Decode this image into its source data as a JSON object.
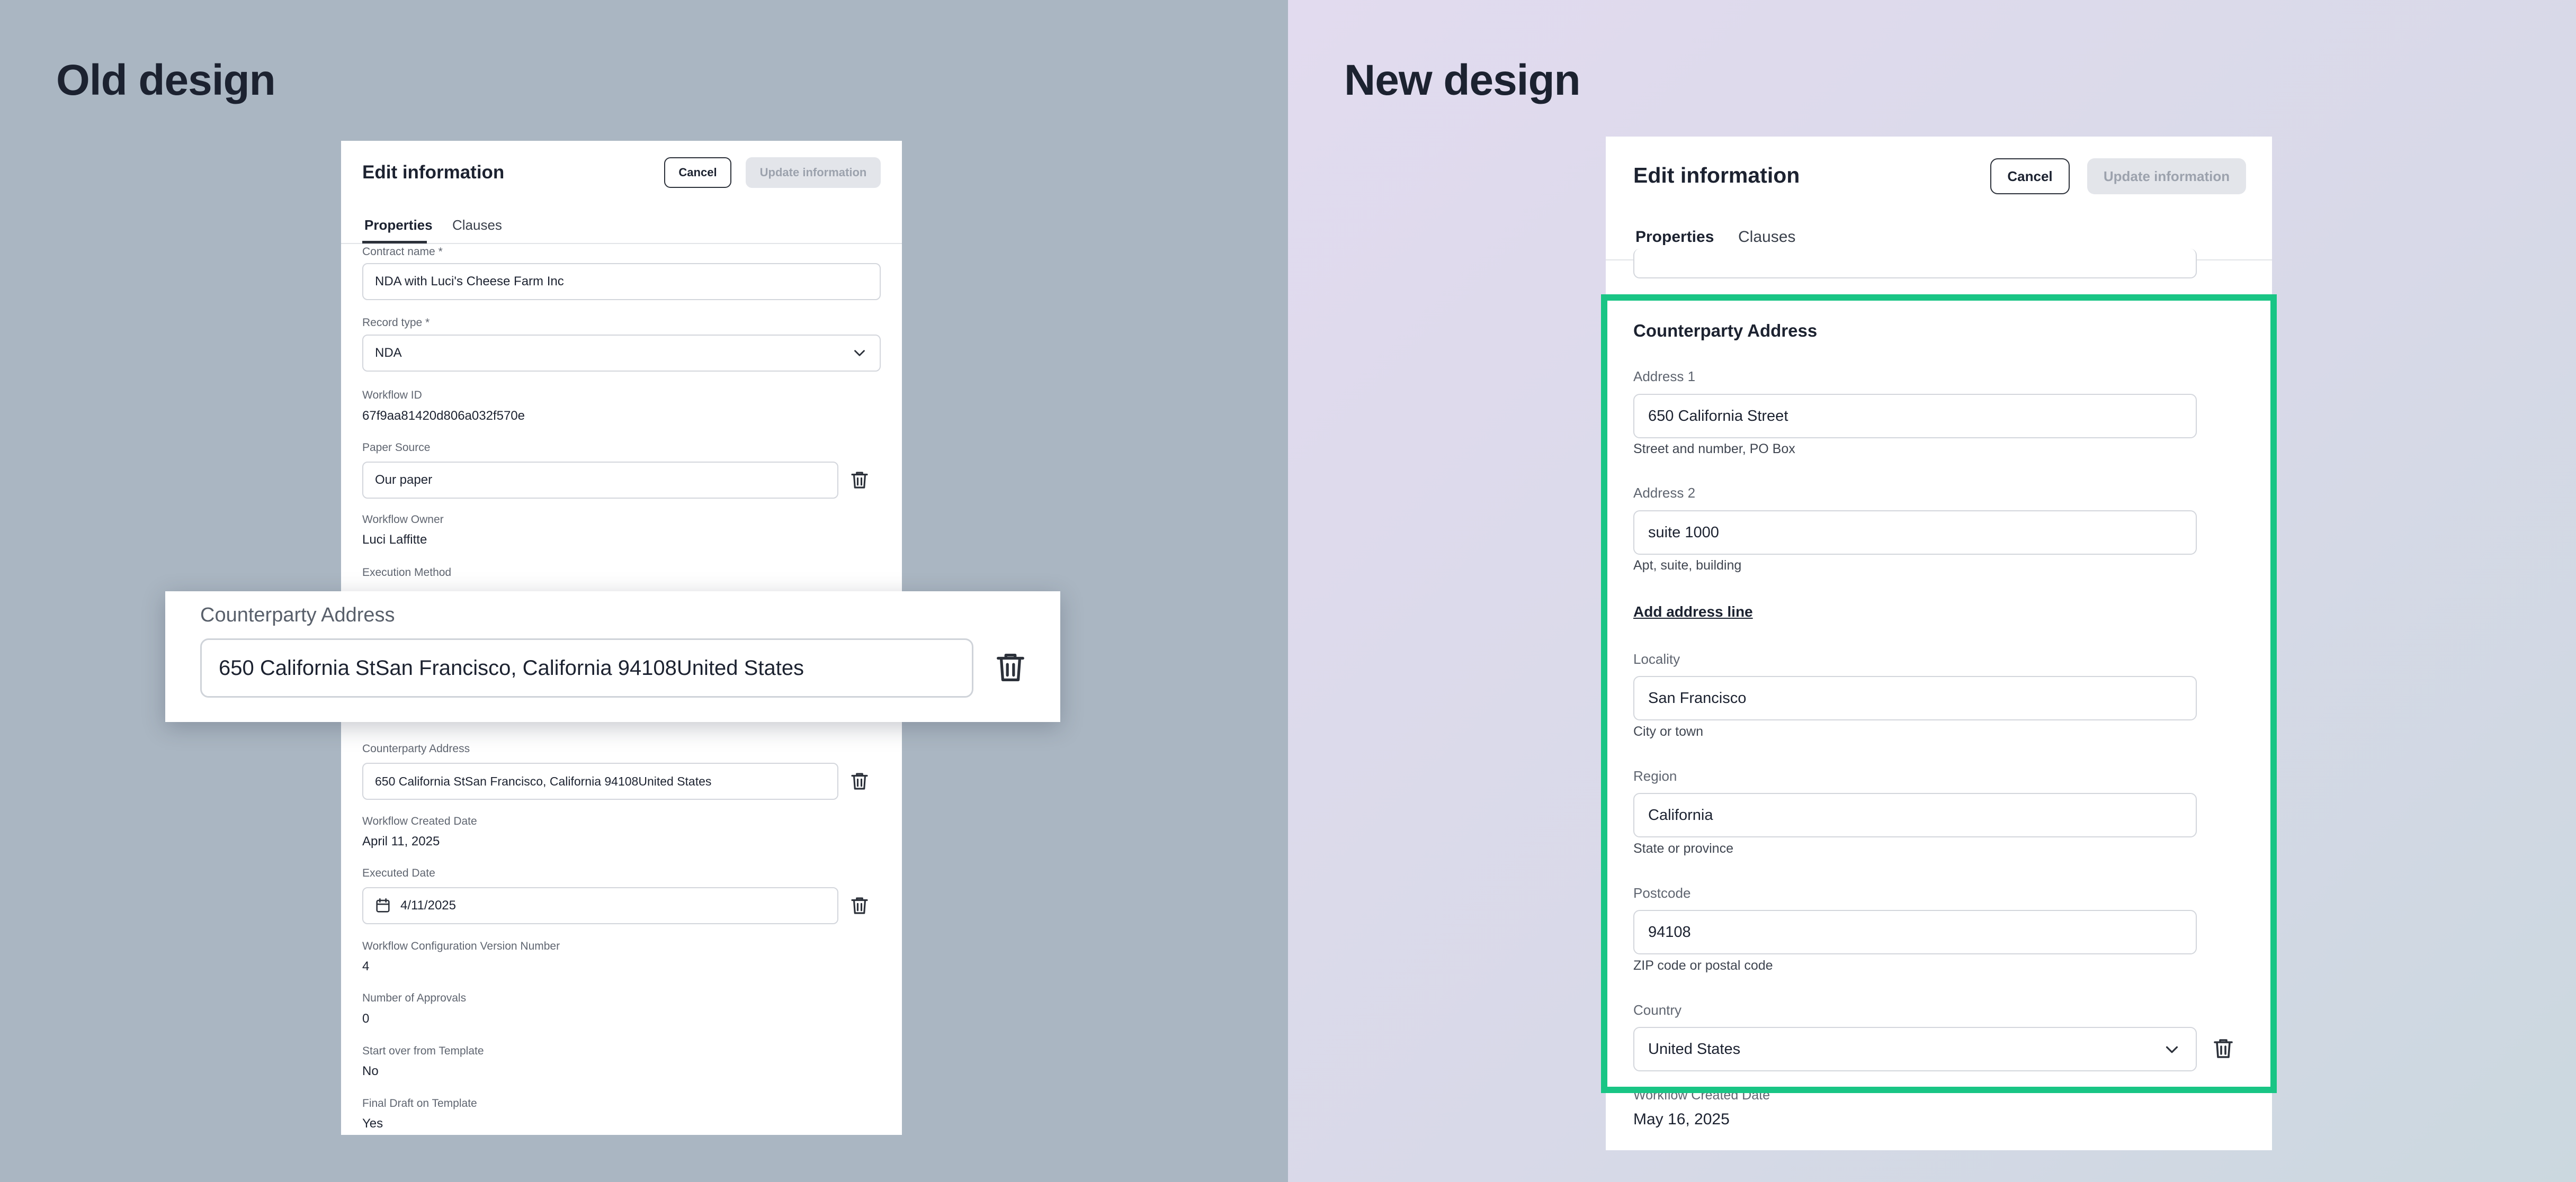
{
  "old": {
    "heading": "Old design",
    "form": {
      "title": "Edit information",
      "cancel_label": "Cancel",
      "update_label": "Update information",
      "tabs": [
        "Properties",
        "Clauses"
      ],
      "contract_name_label": "Contract name *",
      "contract_name_value": "NDA with Luci's Cheese Farm Inc",
      "record_type_label": "Record type *",
      "record_type_value": "NDA",
      "workflow_id_label": "Workflow ID",
      "workflow_id_value": "67f9aa81420d806a032f570e",
      "paper_source_label": "Paper Source",
      "paper_source_value": "Our paper",
      "workflow_owner_label": "Workflow Owner",
      "workflow_owner_value": "Luci Laffitte",
      "execution_method_label": "Execution Method",
      "counterparty_label": "Counterparty Address",
      "counterparty_value": "650 California StSan Francisco, California 94108United States",
      "created_label": "Workflow Created Date",
      "created_value": "April 11, 2025",
      "executed_label": "Executed Date",
      "executed_value": "4/11/2025",
      "config_label": "Workflow Configuration Version Number",
      "config_value": "4",
      "approvals_label": "Number of Approvals",
      "approvals_value": "0",
      "start_over_label": "Start over from Template",
      "start_over_value": "No",
      "final_draft_label": "Final Draft on Template",
      "final_draft_value": "Yes"
    },
    "zoom": {
      "label": "Counterparty Address",
      "value": "650 California StSan Francisco, California 94108United States"
    }
  },
  "new": {
    "heading": "New design",
    "form": {
      "title": "Edit information",
      "cancel_label": "Cancel",
      "update_label": "Update information",
      "tabs": [
        "Properties",
        "Clauses"
      ],
      "section_title": "Counterparty Address",
      "address1_label": "Address 1",
      "address1_value": "650 California Street",
      "address1_hint": "Street and number, PO Box",
      "address2_label": "Address 2",
      "address2_value": "suite 1000",
      "address2_hint": "Apt, suite, building",
      "add_line_label": "Add address line",
      "locality_label": "Locality",
      "locality_value": "San Francisco",
      "locality_hint": "City or town",
      "region_label": "Region",
      "region_value": "California",
      "region_hint": "State or province",
      "postcode_label": "Postcode",
      "postcode_value": "94108",
      "postcode_hint": "ZIP code or postal code",
      "country_label": "Country",
      "country_value": "United States",
      "created_label": "Workflow Created Date",
      "created_value": "May 16, 2025"
    }
  },
  "colors": {
    "left_bg": "#aab6c2",
    "highlight": "#19c585",
    "text": "#1c2230",
    "muted": "#5f6570"
  },
  "icons": [
    "trash-icon",
    "chevron-down-icon",
    "calendar-icon"
  ]
}
